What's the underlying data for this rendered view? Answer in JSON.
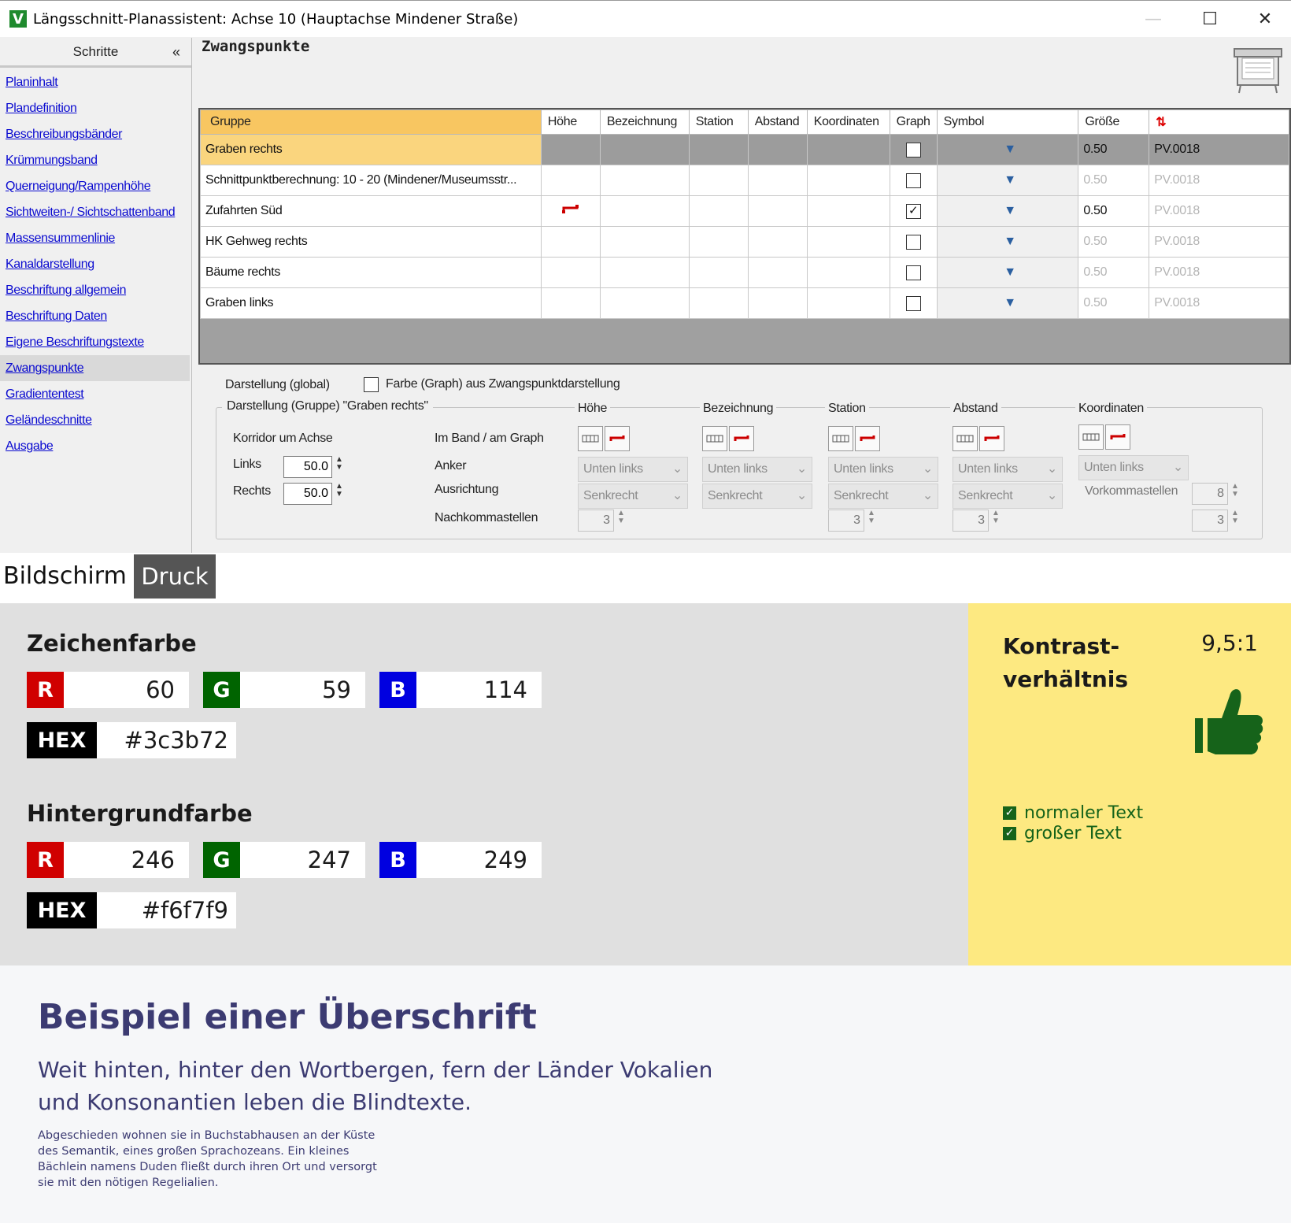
{
  "window": {
    "title": "Längsschnitt-Planassistent: Achse 10 (Hauptachse Mindener Straße)",
    "app_icon": "V",
    "buttons": {
      "minimize": "—",
      "maximize": "☐",
      "close": "✕"
    }
  },
  "sidebar": {
    "header": "Schritte",
    "collapse": "«",
    "items": [
      {
        "label": "Planinhalt"
      },
      {
        "label": "Plandefinition"
      },
      {
        "label": "Beschreibungsbänder"
      },
      {
        "label": "Krümmungsband"
      },
      {
        "label": "Querneigung/Rampenhöhe"
      },
      {
        "label": "Sichtweiten-/ Sichtschattenband"
      },
      {
        "label": "Massensummenlinie"
      },
      {
        "label": "Kanaldarstellung"
      },
      {
        "label": "Beschriftung allgemein"
      },
      {
        "label": "Beschriftung Daten"
      },
      {
        "label": "Eigene Beschriftungstexte"
      },
      {
        "label": "Zwangspunkte",
        "selected": true
      },
      {
        "label": "Gradiententest"
      },
      {
        "label": "Geländeschnitte"
      },
      {
        "label": "Ausgabe"
      }
    ]
  },
  "main": {
    "section_title": "Zwangspunkte",
    "table": {
      "columns": [
        "Gruppe",
        "Höhe",
        "Bezeichnung",
        "Station",
        "Abstand",
        "Koordinaten",
        "Graph",
        "Symbol",
        "Größe",
        ""
      ],
      "rows": [
        {
          "gruppe": "Graben rechts",
          "hoehe_icon": false,
          "graph": "unchecked",
          "groesse": "0.50",
          "symbol": "PV.0018",
          "selected": true
        },
        {
          "gruppe": "Schnittpunktberechnung: 10 - 20 (Mindener/Museumsstr...",
          "hoehe_icon": false,
          "graph": "unchecked",
          "groesse": "0.50",
          "symbol": "PV.0018"
        },
        {
          "gruppe": "Zufahrten Süd",
          "hoehe_icon": true,
          "graph": "checked",
          "groesse": "0.50",
          "symbol": "PV.0018"
        },
        {
          "gruppe": "HK Gehweg rechts",
          "hoehe_icon": false,
          "graph": "unchecked",
          "groesse": "0.50",
          "symbol": "PV.0018"
        },
        {
          "gruppe": "Bäume rechts",
          "hoehe_icon": false,
          "graph": "unchecked",
          "groesse": "0.50",
          "symbol": "PV.0018"
        },
        {
          "gruppe": "Graben links",
          "hoehe_icon": false,
          "graph": "unchecked",
          "groesse": "0.50",
          "symbol": "PV.0018"
        }
      ]
    },
    "darstellung_global": {
      "label": "Darstellung (global)",
      "checkbox_label": "Farbe (Graph) aus Zwangspunktdarstellung"
    },
    "darstellung_gruppe": {
      "legend": "Darstellung (Gruppe) \"Graben rechts\"",
      "korridor": "Korridor um Achse",
      "links_label": "Links",
      "links_value": "50.0",
      "rechts_label": "Rechts",
      "rechts_value": "50.0",
      "im_band": "Im Band / am Graph",
      "anker": "Anker",
      "ausrichtung": "Ausrichtung",
      "nachkomma": "Nachkommastellen",
      "vorkomma": "Vorkommastellen",
      "groups": [
        {
          "title": "Höhe",
          "anker": "Unten links",
          "ausrichtung": "Senkrecht",
          "nachkomma": "3"
        },
        {
          "title": "Bezeichnung",
          "anker": "Unten links",
          "ausrichtung": "Senkrecht"
        },
        {
          "title": "Station",
          "anker": "Unten links",
          "ausrichtung": "Senkrecht",
          "nachkomma": "3"
        },
        {
          "title": "Abstand",
          "anker": "Unten links",
          "ausrichtung": "Senkrecht",
          "nachkomma": "3"
        },
        {
          "title": "Koordinaten",
          "anker": "Unten links",
          "vorkomma": "8",
          "nachkomma": "3"
        }
      ]
    }
  },
  "tabs": {
    "bildschirm": "Bildschirm",
    "druck": "Druck"
  },
  "zeichenfarbe": {
    "title": "Zeichenfarbe",
    "r": "60",
    "g": "59",
    "b": "114",
    "hex": "#3c3b72"
  },
  "hintergrundfarbe": {
    "title": "Hintergrundfarbe",
    "r": "246",
    "g": "247",
    "b": "249",
    "hex": "#f6f7f9"
  },
  "labels": {
    "r": "R",
    "g": "G",
    "b": "B",
    "hex": "HEX"
  },
  "kontrast": {
    "title_line1": "Kontrast-",
    "title_line2": "verhältnis",
    "ratio": "9,5:1",
    "checks": [
      "normaler Text",
      "großer Text"
    ]
  },
  "sample": {
    "heading": "Beispiel einer Überschrift",
    "lead": "Weit hinten, hinter den Wortbergen, fern der Länder Vokalien und Konsonantien leben die Blindtexte.",
    "body": "Abgeschieden wohnen sie in Buchstabhausen an der Küste des Semantik, eines großen Sprachozeans. Ein kleines Bächlein namens Duden fließt durch ihren Ort und versorgt sie mit den nötigen Regelialien."
  },
  "colors": {
    "accent_orange": "#f8c661",
    "link_blue": "#0a0ad0",
    "red": "#d00000",
    "green": "#006400",
    "blue": "#0000e0",
    "text_primary": "#3c3b72",
    "background_sample": "#f6f7f9",
    "contrast_panel": "#fde981",
    "thumb_green": "#16631a"
  }
}
